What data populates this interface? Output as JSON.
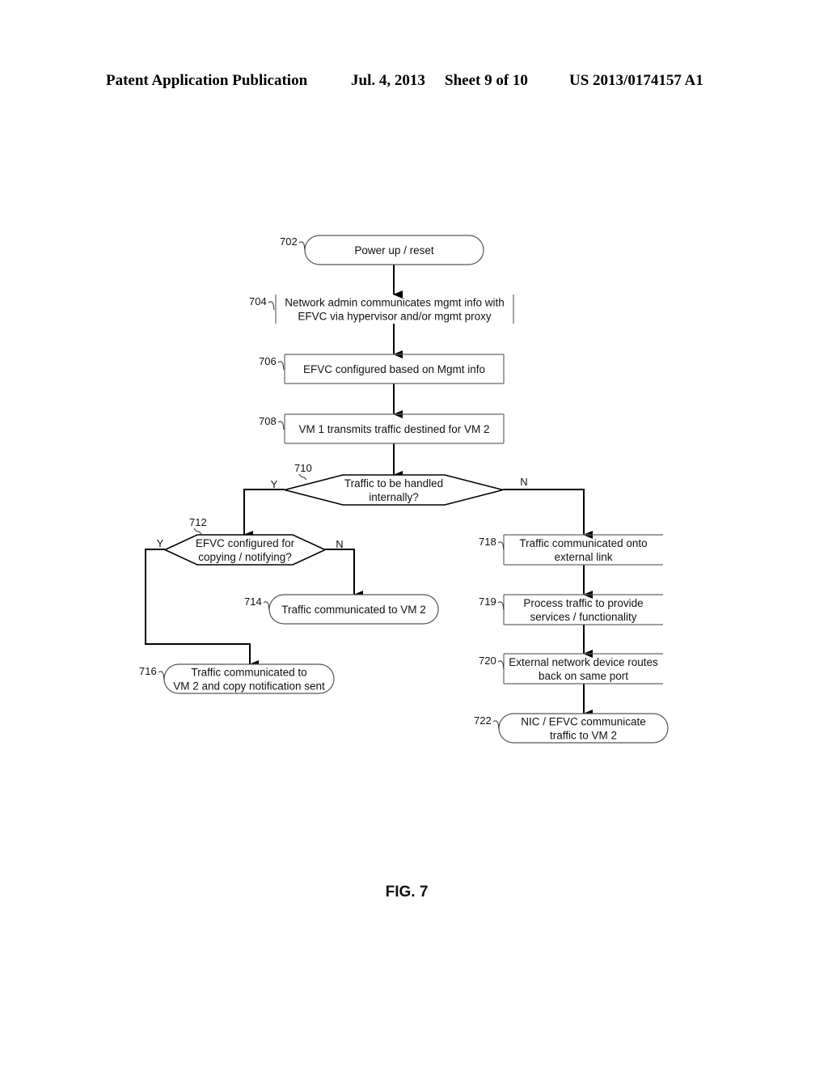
{
  "header": {
    "publication": "Patent Application Publication",
    "date": "Jul. 4, 2013",
    "sheet": "Sheet 9 of 10",
    "number": "US 2013/0174157 A1"
  },
  "flowchart": {
    "nodes": {
      "n702": {
        "ref": "702",
        "shape": "terminal",
        "lines": [
          "Power up / reset"
        ]
      },
      "n704": {
        "ref": "704",
        "shape": "process",
        "lines": [
          "Network admin communicates mgmt info with",
          "EFVC via hypervisor and/or mgmt proxy"
        ]
      },
      "n706": {
        "ref": "706",
        "shape": "process",
        "lines": [
          "EFVC configured based on Mgmt info"
        ]
      },
      "n708": {
        "ref": "708",
        "shape": "process",
        "lines": [
          "VM 1 transmits traffic destined for VM 2"
        ]
      },
      "n710": {
        "ref": "710",
        "shape": "decision",
        "lines": [
          "Traffic to be handled",
          "internally?"
        ],
        "yes_label": "Y",
        "no_label": "N"
      },
      "n712": {
        "ref": "712",
        "shape": "decision",
        "lines": [
          "EFVC configured for",
          "copying / notifying?"
        ],
        "yes_label": "Y",
        "no_label": "N"
      },
      "n714": {
        "ref": "714",
        "shape": "terminal",
        "lines": [
          "Traffic communicated to VM 2"
        ]
      },
      "n716": {
        "ref": "716",
        "shape": "terminal",
        "lines": [
          "Traffic communicated to",
          "VM 2 and copy notification sent"
        ]
      },
      "n718": {
        "ref": "718",
        "shape": "process",
        "lines": [
          "Traffic communicated onto",
          "external link"
        ]
      },
      "n719": {
        "ref": "719",
        "shape": "process",
        "lines": [
          "Process traffic to provide",
          "services / functionality"
        ]
      },
      "n720": {
        "ref": "720",
        "shape": "process",
        "lines": [
          "External network device routes",
          "back on same port"
        ]
      },
      "n722": {
        "ref": "722",
        "shape": "terminal",
        "lines": [
          "NIC / EFVC communicate",
          "traffic to VM 2"
        ]
      }
    },
    "edges": [
      {
        "from": "702",
        "to": "704"
      },
      {
        "from": "704",
        "to": "706"
      },
      {
        "from": "706",
        "to": "708"
      },
      {
        "from": "708",
        "to": "710"
      },
      {
        "from": "710",
        "to": "712",
        "label": "Y"
      },
      {
        "from": "710",
        "to": "718",
        "label": "N"
      },
      {
        "from": "712",
        "to": "716",
        "label": "Y"
      },
      {
        "from": "712",
        "to": "714",
        "label": "N"
      },
      {
        "from": "718",
        "to": "719"
      },
      {
        "from": "719",
        "to": "720"
      },
      {
        "from": "720",
        "to": "722"
      }
    ]
  },
  "figure_label": "FIG. 7"
}
